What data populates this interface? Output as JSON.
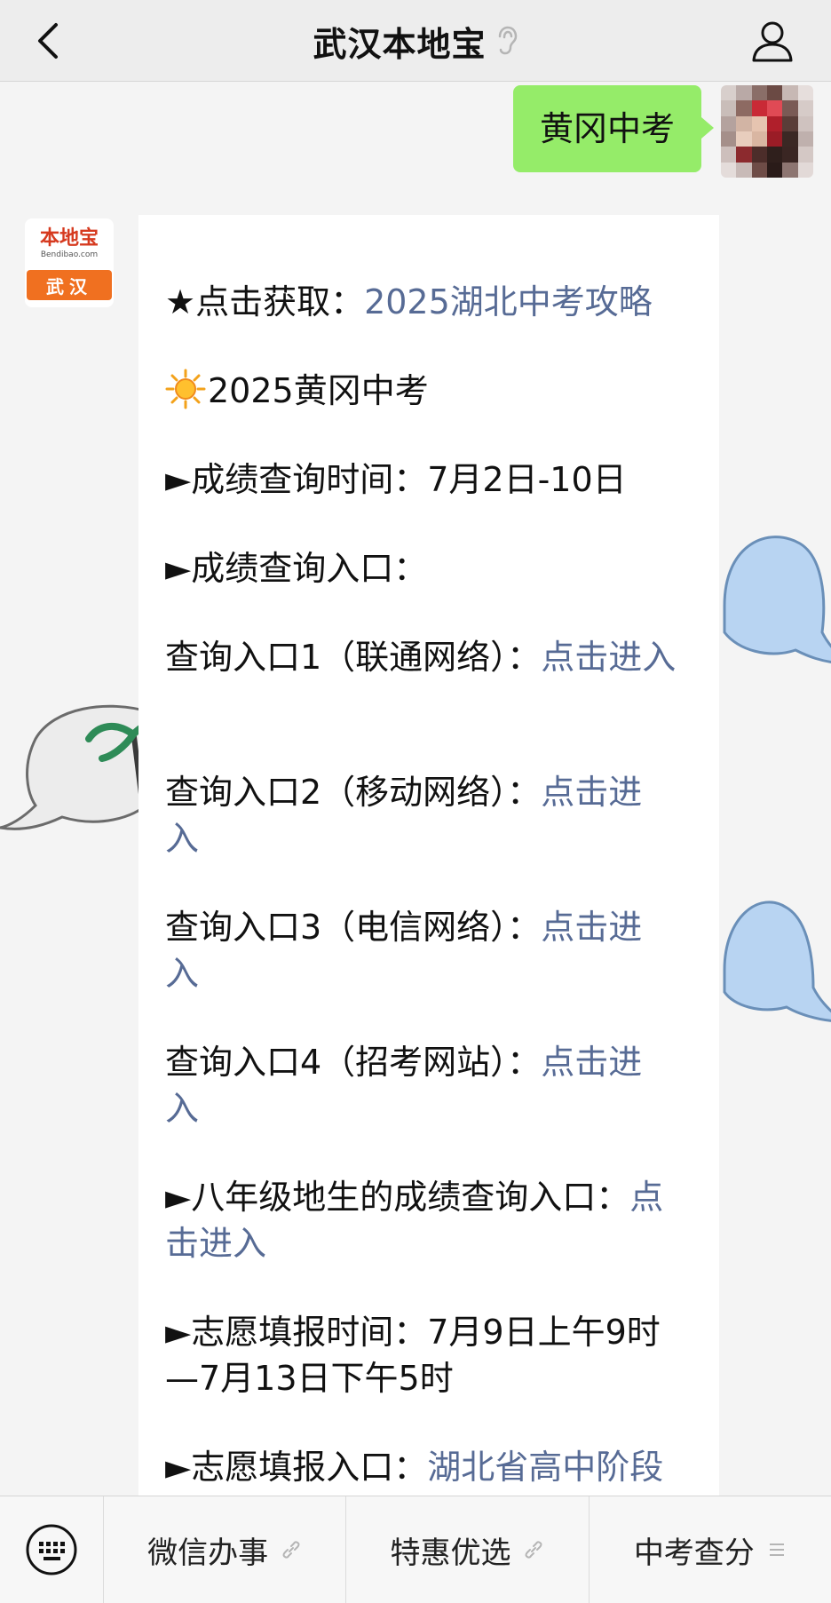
{
  "header": {
    "title": "武汉本地宝"
  },
  "user_message": {
    "text": "黄冈中考"
  },
  "bot": {
    "logo_name": "本地宝",
    "logo_domain": "Bendibao.com",
    "logo_city": "武汉"
  },
  "message": {
    "guide_prefix": "★点击获取：",
    "guide_link": "2025湖北中考攻略",
    "heading": "2025黄冈中考",
    "score_time": "►成绩查询时间：7月2日-10日",
    "score_entry": "►成绩查询入口：",
    "entries": [
      {
        "prefix": "查询入口1（联通网络）：",
        "link": "点击进入"
      },
      {
        "prefix": "查询入口2（移动网络）：",
        "link": "点击进入"
      },
      {
        "prefix": "查询入口3（电信网络）：",
        "link": "点击进入"
      },
      {
        "prefix": "查询入口4（招考网站）：",
        "link": "点击进入"
      }
    ],
    "grade8_prefix": "►八年级地生的成绩查询入口：",
    "grade8_link": "点击进入",
    "volunteer_time": "►志愿填报时间：7月9日上午9时—7月13日下午5时",
    "volunteer_prefix": "►志愿填报入口：",
    "volunteer_link": "湖北省高中阶段学校招生管理信息系统"
  },
  "bottom_menu": {
    "items": [
      {
        "label": "微信办事",
        "icon": "link-icon"
      },
      {
        "label": "特惠优选",
        "icon": "link-icon"
      },
      {
        "label": "中考查分",
        "icon": "menu-lines-icon"
      }
    ]
  },
  "colors": {
    "link": "#576b95",
    "user_bubble": "#95ec69",
    "logo_orange": "#f07020"
  }
}
